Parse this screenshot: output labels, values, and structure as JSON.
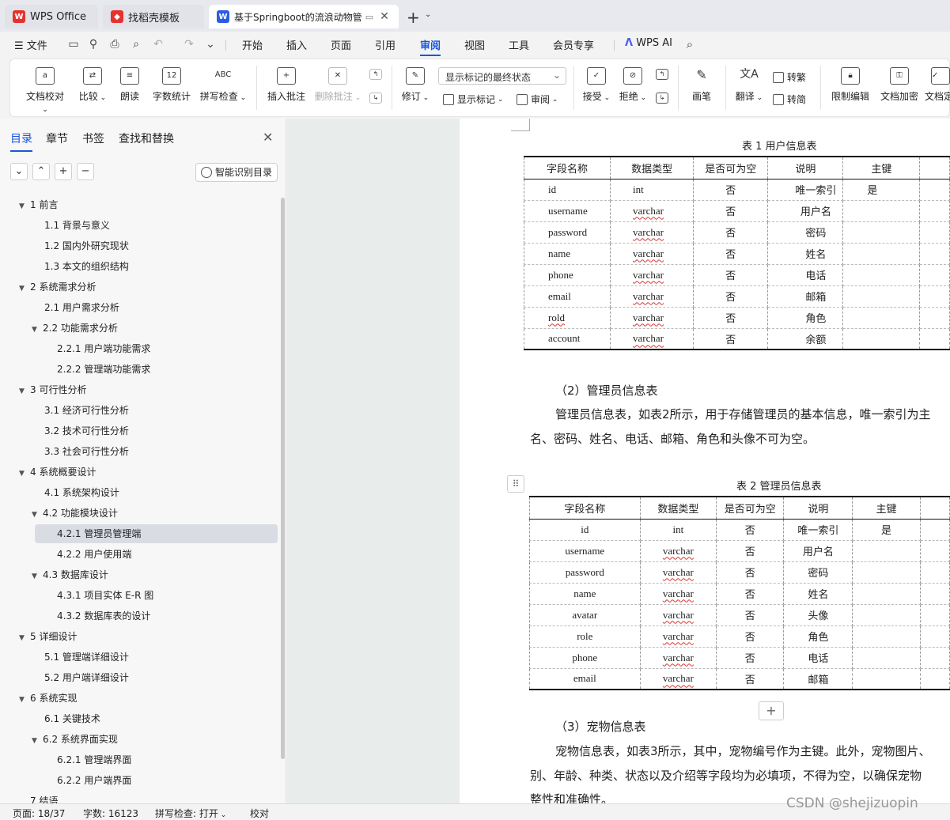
{
  "tabs": [
    {
      "label": "WPS Office",
      "icon": "wps-logo-icon",
      "color": "#e5322d"
    },
    {
      "label": "找稻壳模板",
      "icon": "docer-icon",
      "color": "#e5322d"
    },
    {
      "label": "基于Springboot的流浪动物管",
      "icon": "word-doc-icon",
      "color": "#2b5ce6"
    }
  ],
  "menubar": {
    "file": "文件",
    "items": [
      "开始",
      "插入",
      "页面",
      "引用",
      "审阅",
      "视图",
      "工具",
      "会员专享"
    ],
    "active": "审阅",
    "wps_ai": "WPS AI"
  },
  "ribbon": {
    "doc_check": "文档校对",
    "compare": "比较",
    "read_aloud": "朗读",
    "word_count": "字数统计",
    "spell_check": "拼写检查",
    "insert_comment": "插入批注",
    "delete_comment": "删除批注",
    "revise": "修订",
    "markup_mode": "显示标记的最终状态",
    "show_markup": "显示标记",
    "review": "审阅",
    "accept": "接受",
    "reject": "拒绝",
    "ink": "画笔",
    "translate": "翻译",
    "to_traditional": "转繁",
    "to_simplified": "转简",
    "restrict_edit": "限制编辑",
    "encrypt": "文档加密",
    "doc_final": "文档定"
  },
  "nav": {
    "tabs": [
      "目录",
      "章节",
      "书签",
      "查找和替换"
    ],
    "active_tab": "目录",
    "smart_toc": "智能识别目录",
    "toc": [
      {
        "label": "1 前言",
        "level": 1,
        "arrow": true
      },
      {
        "label": "1.1 背景与意义",
        "level": 2
      },
      {
        "label": "1.2 国内外研究现状",
        "level": 2
      },
      {
        "label": "1.3 本文的组织结构",
        "level": 2
      },
      {
        "label": "2 系统需求分析",
        "level": 1,
        "arrow": true
      },
      {
        "label": "2.1 用户需求分析",
        "level": 2
      },
      {
        "label": "2.2 功能需求分析",
        "level": 2,
        "arrow": true
      },
      {
        "label": "2.2.1 用户端功能需求",
        "level": 3
      },
      {
        "label": "2.2.2 管理端功能需求",
        "level": 3
      },
      {
        "label": "3 可行性分析",
        "level": 1,
        "arrow": true
      },
      {
        "label": "3.1 经济可行性分析",
        "level": 2
      },
      {
        "label": "3.2 技术可行性分析",
        "level": 2
      },
      {
        "label": "3.3 社会可行性分析",
        "level": 2
      },
      {
        "label": "4 系统概要设计",
        "level": 1,
        "arrow": true
      },
      {
        "label": "4.1 系统架构设计",
        "level": 2
      },
      {
        "label": "4.2 功能模块设计",
        "level": 2,
        "arrow": true
      },
      {
        "label": "4.2.1 管理员管理端",
        "level": 3,
        "selected": true
      },
      {
        "label": "4.2.2 用户使用端",
        "level": 3
      },
      {
        "label": "4.3 数据库设计",
        "level": 2,
        "arrow": true
      },
      {
        "label": "4.3.1 项目实体 E-R 图",
        "level": 3
      },
      {
        "label": "4.3.2 数据库表的设计",
        "level": 3
      },
      {
        "label": "5 详细设计",
        "level": 1,
        "arrow": true
      },
      {
        "label": "5.1 管理端详细设计",
        "level": 2
      },
      {
        "label": "5.2 用户端详细设计",
        "level": 2
      },
      {
        "label": "6  系统实现",
        "level": 1,
        "arrow": true
      },
      {
        "label": "6.1 关键技术",
        "level": 2
      },
      {
        "label": "6.2 系统界面实现",
        "level": 2,
        "arrow": true
      },
      {
        "label": "6.2.1 管理端界面",
        "level": 3
      },
      {
        "label": "6.2.2 用户端界面",
        "level": 3
      },
      {
        "label": "7 结语",
        "level": 1
      }
    ]
  },
  "document": {
    "table1": {
      "caption": "表 1 用户信息表",
      "headers": [
        "字段名称",
        "数据类型",
        "是否可为空",
        "说明",
        "主键"
      ],
      "rows": [
        [
          "id",
          "int",
          "否",
          "唯一索引",
          "是"
        ],
        [
          "username",
          "varchar",
          "否",
          "用户名",
          ""
        ],
        [
          "password",
          "varchar",
          "否",
          "密码",
          ""
        ],
        [
          "name",
          "varchar",
          "否",
          "姓名",
          ""
        ],
        [
          "phone",
          "varchar",
          "否",
          "电话",
          ""
        ],
        [
          "email",
          "varchar",
          "否",
          "邮箱",
          ""
        ],
        [
          "rold",
          "varchar",
          "否",
          "角色",
          ""
        ],
        [
          "account",
          "varchar",
          "否",
          "余额",
          ""
        ]
      ]
    },
    "section2_title": "（2）管理员信息表",
    "section2_line1": "管理员信息表，如表2所示，用于存储管理员的基本信息，唯一索引为主",
    "section2_line2": "名、密码、姓名、电话、邮箱、角色和头像不可为空。",
    "table2": {
      "caption": "表 2 管理员信息表",
      "headers": [
        "字段名称",
        "数据类型",
        "是否可为空",
        "说明",
        "主键"
      ],
      "rows": [
        [
          "id",
          "int",
          "否",
          "唯一索引",
          "是"
        ],
        [
          "username",
          "varchar",
          "否",
          "用户名",
          ""
        ],
        [
          "password",
          "varchar",
          "否",
          "密码",
          ""
        ],
        [
          "name",
          "varchar",
          "否",
          "姓名",
          ""
        ],
        [
          "avatar",
          "varchar",
          "否",
          "头像",
          ""
        ],
        [
          "role",
          "varchar",
          "否",
          "角色",
          ""
        ],
        [
          "phone",
          "varchar",
          "否",
          "电话",
          ""
        ],
        [
          "email",
          "varchar",
          "否",
          "邮箱",
          ""
        ]
      ]
    },
    "section3_title": "（3）宠物信息表",
    "section3_line1": "宠物信息表，如表3所示，其中，宠物编号作为主键。此外，宠物图片、",
    "section3_line2": "别、年龄、种类、状态以及介绍等字段均为必填项，不得为空，以确保宠物",
    "section3_line3": "整性和准确性。"
  },
  "status": {
    "page": "页面: 18/37",
    "words": "字数: 16123",
    "spell": "拼写检查: 打开",
    "proof": "校对"
  },
  "watermark": "CSDN @shejizuopin"
}
